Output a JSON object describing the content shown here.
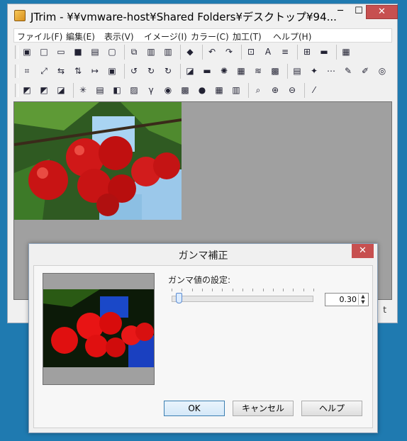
{
  "window": {
    "title": "JTrim - ¥¥vmware-host¥Shared Folders¥デスクトップ¥94...",
    "minimize": "─",
    "maximize": "☐",
    "close": "✕"
  },
  "menu": {
    "items": [
      "ファイル(F)",
      "編集(E)",
      "表示(V)",
      "イメージ(I)",
      "カラー(C)",
      "加工(T)",
      "ヘルプ(H)"
    ]
  },
  "toolbar1": {
    "icons": [
      "new-window-icon",
      "new-icon",
      "open-icon",
      "save-icon",
      "print-icon",
      "print-preview-icon",
      "copy-icon",
      "paste-icon",
      "paste-new-icon",
      "capture-icon",
      "undo-icon",
      "redo-icon",
      "fit-icon",
      "text-icon",
      "align-icon",
      "tile-icon",
      "filmstrip-icon",
      "grid-menu-icon"
    ],
    "glyphs": [
      "▣",
      "□",
      "▭",
      "■",
      "▤",
      "▢",
      "⧉",
      "▥",
      "▥",
      "◆",
      "↶",
      "↷",
      "⊡",
      "A",
      "≡",
      "⊞",
      "▬",
      "▦"
    ]
  },
  "toolbar2": {
    "icons": [
      "crop-icon",
      "resize-icon",
      "flip-horizontal-icon",
      "flip-vertical-icon",
      "trim-icon",
      "frame-icon",
      "rotate-left-90-icon",
      "rotate-right-90-icon",
      "rotate-free-icon",
      "shadow-icon",
      "emboss-icon",
      "blur-icon",
      "mosaic-icon",
      "wave-icon",
      "noise-icon",
      "brick-icon",
      "sharpen-icon",
      "lens-icon",
      "pen-icon",
      "marker-icon",
      "swirl-icon"
    ],
    "glyphs": [
      "⌗",
      "⤢",
      "⇆",
      "⇅",
      "↦",
      "▣",
      "↺",
      "↻",
      "↻",
      "◪",
      "▬",
      "✺",
      "▦",
      "≋",
      "▩",
      "▤",
      "✦",
      "⋯",
      "✎",
      "✐",
      "◎"
    ]
  },
  "toolbar3": {
    "icons": [
      "gray-icon",
      "sepia-icon",
      "invert-icon",
      "sparkle-icon",
      "color-balance-icon",
      "hue-icon",
      "brightness-icon",
      "gamma-icon",
      "palette-icon",
      "checker-icon",
      "rgb-icon",
      "xor-icon",
      "gradient-icon",
      "zoom-icon",
      "zoom-in-icon",
      "zoom-out-icon",
      "eyedropper-icon"
    ],
    "glyphs": [
      "◩",
      "◩",
      "◪",
      "✳",
      "▤",
      "◧",
      "▨",
      "γ",
      "◉",
      "▩",
      "●",
      "▦",
      "▥",
      "⌕",
      "⊕",
      "⊖",
      "⁄"
    ]
  },
  "statusbar": {
    "text": "t"
  },
  "dialog": {
    "title": "ガンマ補正",
    "close": "✕",
    "gamma_label": "ガンマ値の設定:",
    "gamma_value": "0.30",
    "slider_fraction": 0.05,
    "ok": "OK",
    "cancel": "キャンセル",
    "help": "ヘルプ"
  }
}
